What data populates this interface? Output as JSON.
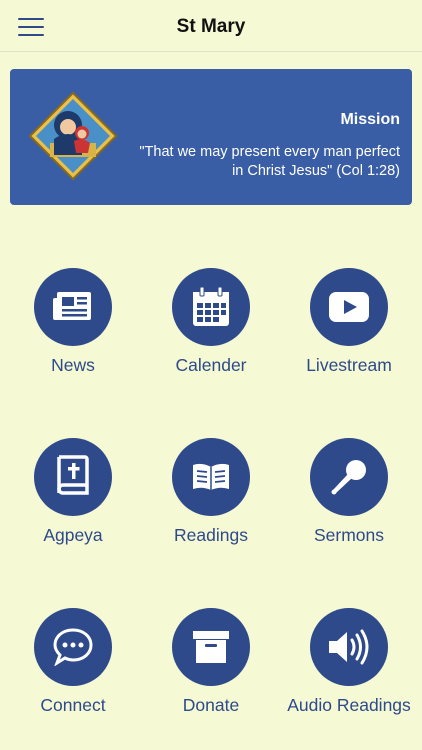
{
  "header": {
    "title": "St Mary"
  },
  "mission": {
    "title": "Mission",
    "text": "\"That we may present every man perfect in Christ Jesus\" (Col 1:28)"
  },
  "tiles": [
    {
      "label": "News",
      "icon": "newspaper-icon"
    },
    {
      "label": "Calender",
      "icon": "calendar-icon"
    },
    {
      "label": "Livestream",
      "icon": "play-icon"
    },
    {
      "label": "Agpeya",
      "icon": "bible-icon"
    },
    {
      "label": "Readings",
      "icon": "open-book-icon"
    },
    {
      "label": "Sermons",
      "icon": "microphone-icon"
    },
    {
      "label": "Connect",
      "icon": "chat-bubble-icon"
    },
    {
      "label": "Donate",
      "icon": "archive-box-icon"
    },
    {
      "label": "Audio Readings",
      "icon": "speaker-icon"
    }
  ],
  "colors": {
    "background": "#f5f9d4",
    "accent": "#2e4a8a",
    "banner": "#3a5ea5"
  }
}
